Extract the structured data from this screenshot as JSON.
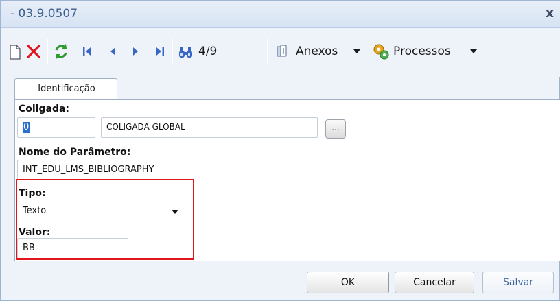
{
  "window": {
    "title": "- 03.9.0507",
    "close_label": "x"
  },
  "toolbar": {
    "record_position": "4/9",
    "attachments_label": "Anexos",
    "processes_label": "Processos",
    "icons": [
      "new-icon",
      "delete-icon",
      "refresh-icon",
      "first-record-icon",
      "previous-record-icon",
      "next-record-icon",
      "last-record-icon",
      "find-icon",
      "attachment-icon",
      "processes-icon"
    ],
    "colors": {
      "delete": "#e0161c",
      "refresh": "#2e9a2e",
      "nav": "#3a67c4"
    }
  },
  "tabs": [
    {
      "label": "Identificação"
    }
  ],
  "form": {
    "coligada": {
      "label": "Coligada:",
      "code_value": "0",
      "name_value": "COLIGADA GLOBAL",
      "lookup_label": "..."
    },
    "nome_parametro": {
      "label": "Nome do Parâmetro:",
      "value": "INT_EDU_LMS_BIBLIOGRAPHY"
    },
    "tipo": {
      "label": "Tipo:",
      "selected": "Texto"
    },
    "valor": {
      "label": "Valor:",
      "value": "BB"
    },
    "highlight_color": "#e0161c"
  },
  "buttons": {
    "ok": "OK",
    "cancel": "Cancelar",
    "save": "Salvar"
  }
}
